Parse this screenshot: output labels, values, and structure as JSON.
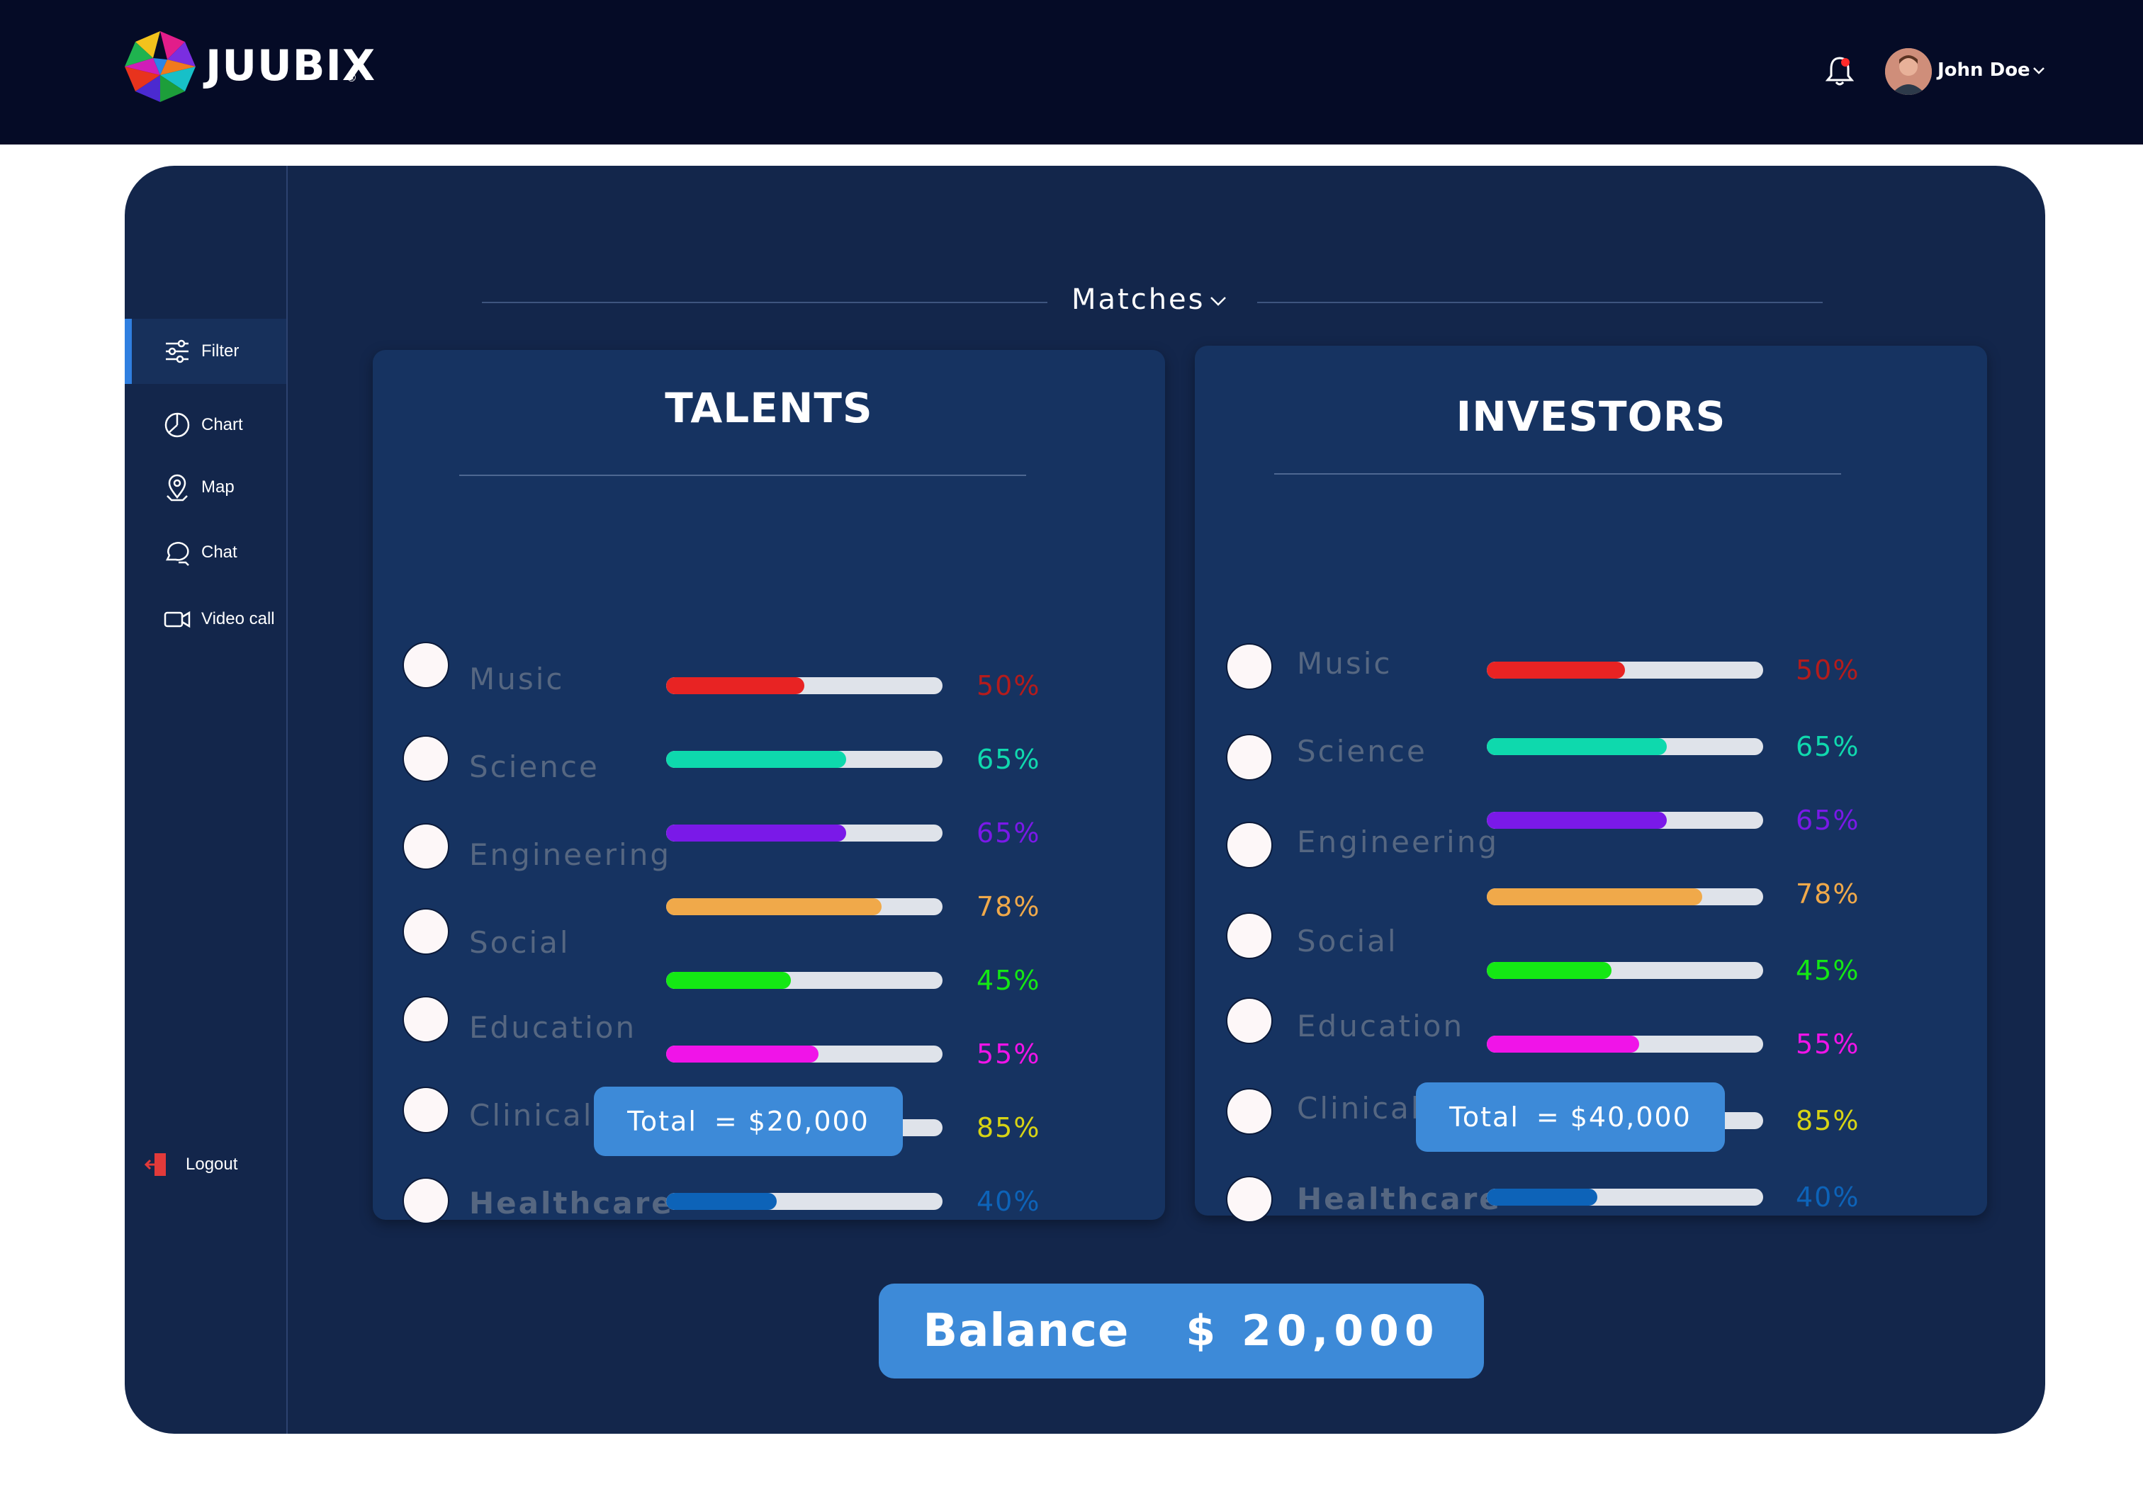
{
  "brand": {
    "name": "JUUBIX",
    "reg_mark": "®"
  },
  "header": {
    "user_name": "John Doe",
    "bell_icon": "bell-icon",
    "caret_icon": "chevron-down-icon"
  },
  "sidebar": {
    "items": [
      {
        "label": "Filter",
        "icon": "sliders-icon",
        "active": true
      },
      {
        "label": "Chart",
        "icon": "pie-chart-icon"
      },
      {
        "label": "Map",
        "icon": "map-pin-icon"
      },
      {
        "label": "Chat",
        "icon": "chat-bubble-icon"
      },
      {
        "label": "Video call",
        "icon": "video-camera-icon"
      }
    ],
    "logout_label": "Logout"
  },
  "matches": {
    "label": "Matches"
  },
  "categories": [
    "Music",
    "Science",
    "Engineering",
    "Social",
    "Education",
    "Clinical",
    "Healthcare"
  ],
  "colors": {
    "Music": "#e82323",
    "Science": "#0ed9ad",
    "Engineering": "#7a19e8",
    "Social": "#f0a94a",
    "Education": "#14e814",
    "Clinical": "#f014e8",
    "Healthcare": "#f0ef14",
    "Extra": "#0d63b8"
  },
  "talents": {
    "title": "TALENTS",
    "bars": [
      {
        "pct": 0.5,
        "label": "50%"
      },
      {
        "pct": 0.65,
        "label": "65%"
      },
      {
        "pct": 0.65,
        "label": "65%"
      },
      {
        "pct": 0.78,
        "label": "78%"
      },
      {
        "pct": 0.45,
        "label": "45%"
      },
      {
        "pct": 0.55,
        "label": "55%"
      },
      {
        "pct": 0.85,
        "label": "85%"
      },
      {
        "pct": 0.4,
        "label": "40%"
      }
    ],
    "total_label": "Total",
    "total_eq": "=",
    "total_value": "$20,000"
  },
  "investors": {
    "title": "INVESTORS",
    "bars": [
      {
        "pct": 0.5,
        "label": "50%"
      },
      {
        "pct": 0.65,
        "label": "65%"
      },
      {
        "pct": 0.65,
        "label": "65%"
      },
      {
        "pct": 0.78,
        "label": "78%"
      },
      {
        "pct": 0.45,
        "label": "45%"
      },
      {
        "pct": 0.55,
        "label": "55%"
      },
      {
        "pct": 0.85,
        "label": "85%"
      },
      {
        "pct": 0.4,
        "label": "40%"
      }
    ],
    "total_label": "Total",
    "total_eq": "=",
    "total_value": "$40,000"
  },
  "balance": {
    "label": "Balance",
    "value": "$ 20,000"
  }
}
